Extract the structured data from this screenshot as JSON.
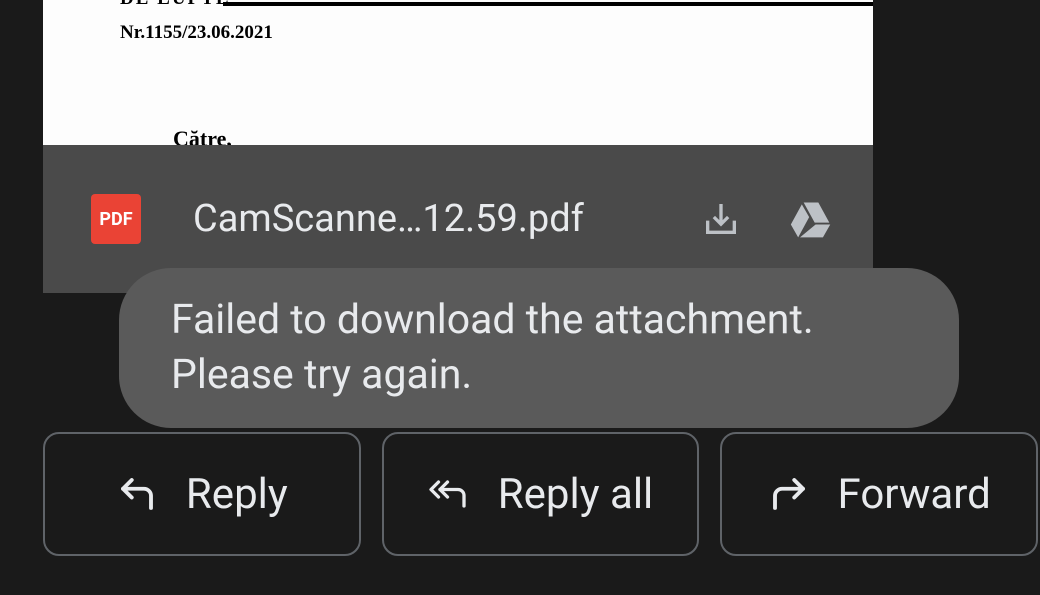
{
  "document": {
    "line1": "DE LUPTE",
    "nr": "Nr.1155/23.06.2021",
    "catre": "Către,"
  },
  "attachment": {
    "icon_label": "PDF",
    "name": "CamScanne…12.59.pdf"
  },
  "toast": {
    "message": "Failed to download the attachment. Please try again."
  },
  "actions": {
    "reply": "Reply",
    "reply_all": "Reply all",
    "forward": "Forward"
  }
}
